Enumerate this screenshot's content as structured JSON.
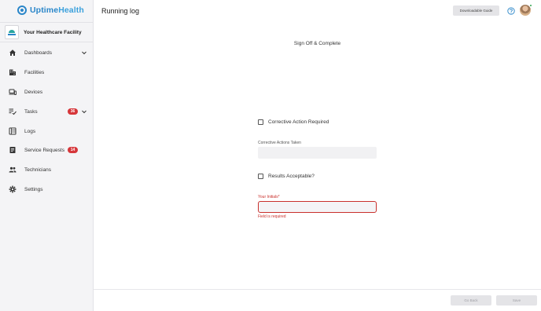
{
  "brand": {
    "name_part1": "Uptime",
    "name_part2": "Health",
    "accent_color": "#2a86c9"
  },
  "facility": {
    "name": "Your Healthcare Facility",
    "logo_icon": "facility-logo-icon"
  },
  "sidebar": {
    "items": [
      {
        "label": "Dashboards",
        "icon": "home-icon",
        "has_chevron": true
      },
      {
        "label": "Facilities",
        "icon": "building-icon"
      },
      {
        "label": "Devices",
        "icon": "devices-icon"
      },
      {
        "label": "Tasks",
        "icon": "task-list-icon",
        "badge": "36",
        "has_chevron": true
      },
      {
        "label": "Logs",
        "icon": "log-icon"
      },
      {
        "label": "Service Requests",
        "icon": "document-icon",
        "badge": "14"
      },
      {
        "label": "Technicians",
        "icon": "people-icon"
      },
      {
        "label": "Settings",
        "icon": "gear-icon"
      }
    ],
    "badge_color": "#d6363a"
  },
  "header": {
    "title": "Running log",
    "guide_button": "Downloadable Guide",
    "help_icon": "help-circle-icon",
    "avatar": "user-avatar"
  },
  "form": {
    "section_title": "Sign Off & Complete",
    "corrective_action_required": {
      "label": "Corrective Action Required",
      "checked": false
    },
    "corrective_actions_taken": {
      "label": "Corrective Actions Taken",
      "value": ""
    },
    "results_acceptable": {
      "label": "Results Acceptable?",
      "checked": false
    },
    "initials": {
      "label": "Your Initials*",
      "value": "",
      "error": "Field is required"
    },
    "error_color": "#c9302c"
  },
  "footer": {
    "back_label": "Go Back",
    "save_label": "Save"
  }
}
